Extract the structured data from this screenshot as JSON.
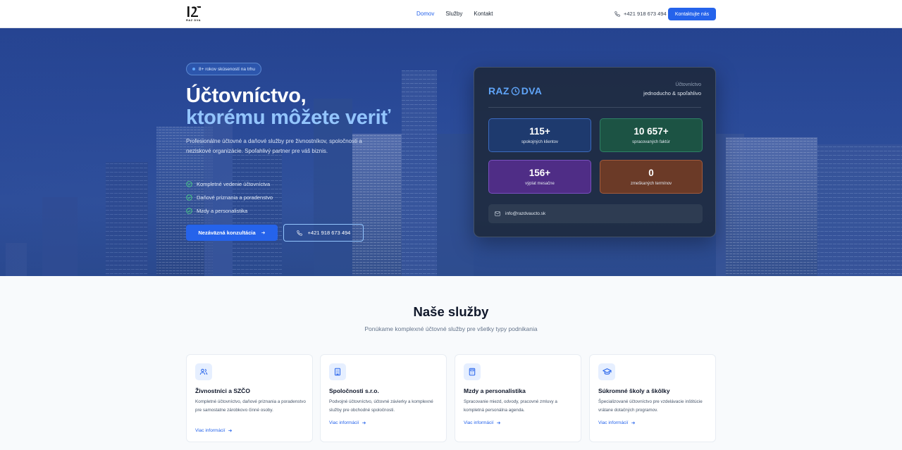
{
  "nav": {
    "logo_sub": "RAZ DVA",
    "links": [
      "Domov",
      "Služby",
      "Kontakt"
    ],
    "phone": "+421 918 673 494",
    "cta": "Kontaktujte nás"
  },
  "hero": {
    "badge": "8+ rokov skúseností na trhu",
    "title_line1": "Účtovníctvo,",
    "title_line2": "ktorému môžete veriť",
    "description": "Profesionálne účtovné a daňové služby pre živnostníkov, spoločnosti a neziskové organizácie. Spoľahlivý partner pre váš biznis.",
    "checks": [
      "Kompletné vedenie účtovníctva",
      "Daňové priznania a poradenstvo",
      "Mzdy a personalistika"
    ],
    "primary_button": "Nezáväzná konzultácia",
    "phone_button": "+421 918 673 494"
  },
  "card": {
    "logo_left": "RAZ",
    "logo_right": "DVA",
    "meta_top": "Účtovníctvo",
    "meta_bottom": "jednoducho & spoľahlivo",
    "stats": [
      {
        "value": "115+",
        "label": "spokojných klientov"
      },
      {
        "value": "10 657+",
        "label": "spracovaných faktúr"
      },
      {
        "value": "156+",
        "label": "výplat mesačne"
      },
      {
        "value": "0",
        "label": "zmeškaných termínov"
      }
    ],
    "email": "info@razdvaucto.sk"
  },
  "services": {
    "title": "Naše služby",
    "subtitle": "Ponúkame komplexné účtovné služby pre všetky typy podnikania",
    "link_label": "Viac informácií",
    "items": [
      {
        "icon": "users-icon",
        "title": "Živnostníci a SZČO",
        "description": "Kompletné účtovníctvo, daňové priznania a poradenstvo pre samostatne zárobkovo činné osoby."
      },
      {
        "icon": "building-icon",
        "title": "Spoločnosti s.r.o.",
        "description": "Podvojné účtovníctvo, účtovné závierky a komplexné služby pre obchodné spoločnosti."
      },
      {
        "icon": "calculator-icon",
        "title": "Mzdy a personalistika",
        "description": "Spracovanie miezd, odvody, pracovné zmluvy a kompletná personálna agenda."
      },
      {
        "icon": "graduation-cap-icon",
        "title": "Súkromné školy a škôlky",
        "description": "Špecializované účtovníctvo pre vzdelávacie inštitúcie vrátane dotačných programov."
      }
    ]
  },
  "colors": {
    "accent": "#2563eb",
    "hero_title_accent": "#93c5fd",
    "card_bg": "#1e293b"
  }
}
